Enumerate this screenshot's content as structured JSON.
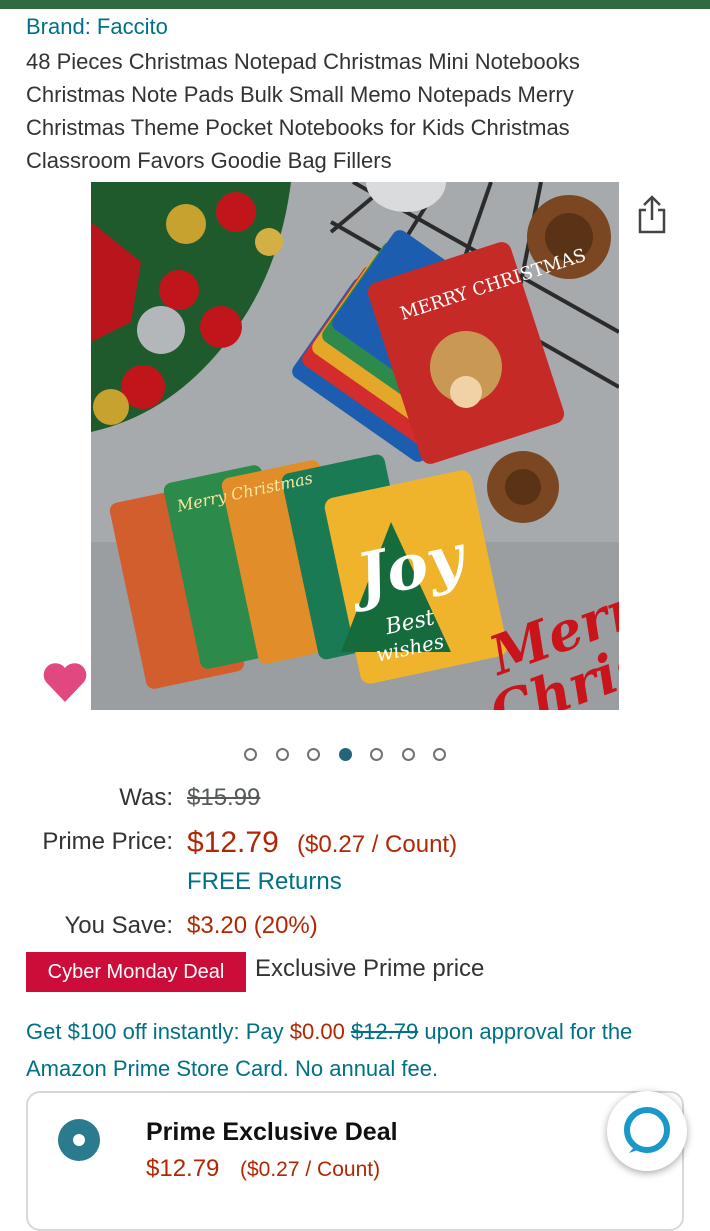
{
  "product": {
    "brand": "Brand: Faccito",
    "title": "48 Pieces Christmas Notepad Christmas Mini Notebooks Christmas Note Pads Bulk Small Memo Notepads Merry Christmas Theme Pocket Notebooks for Kids Christmas Classroom Favors Goodie Bag Fillers"
  },
  "gallery": {
    "image_count": 7,
    "active_index": 3,
    "image_text": {
      "card1": "MERRY CHRISTMAS",
      "card2": "Merry Christmas",
      "joy": "Joy",
      "best": "Best",
      "wishes": "wishes",
      "sign1": "Merry",
      "sign2": "Christm"
    },
    "icons": [
      "share-icon",
      "heart-icon"
    ]
  },
  "pricing": {
    "was_label": "Was:",
    "was_value": "$15.99",
    "prime_label": "Prime Price:",
    "prime_value": "$12.79",
    "prime_unit": "($0.27 / Count)",
    "free_returns": "FREE Returns",
    "save_label": "You Save:",
    "save_value": "$3.20 (20%)"
  },
  "deal": {
    "badge": "Cyber Monday Deal",
    "text": "Exclusive Prime price"
  },
  "promo": {
    "part1": "Get $100 off instantly: Pay ",
    "pay_value": "$0.00",
    "strike_value": "$12.79",
    "part2": " upon approval for the Amazon Prime Store Card. No annual fee."
  },
  "deal_card": {
    "title": "Prime Exclusive Deal",
    "price": "$12.79",
    "unit": "($0.27 / Count)"
  },
  "colors": {
    "link": "#007185",
    "price": "#b12704",
    "badge": "#cc0c39",
    "top_bar": "#2e6b3e"
  }
}
